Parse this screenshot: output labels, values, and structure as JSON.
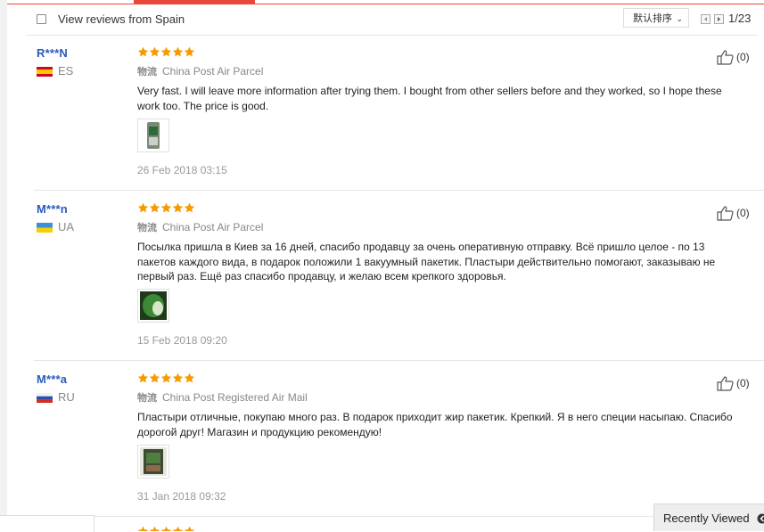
{
  "filter": {
    "label": "View reviews from Spain",
    "sort_label": "默认排序",
    "page_count": "1/23"
  },
  "reviews": [
    {
      "user": "R***N",
      "country": "ES",
      "stars": 5,
      "shipping_label": "物流",
      "shipping": "China Post Air Parcel",
      "text": "Very fast. I will leave more information after trying them. I bought from other sellers before and they worked, so I hope these work too. The price is good.",
      "date": "26 Feb 2018 03:15",
      "likes": "(0)"
    },
    {
      "user": "M***n",
      "country": "UA",
      "stars": 5,
      "shipping_label": "物流",
      "shipping": "China Post Air Parcel",
      "text": "Посылка пришла в Киев за 16 дней, спасибо продавцу за очень оперативную отправку. Всё пришло целое - по 13 пакетов каждого вида, в подарок положили 1 вакуумный пакетик. Пластыри действительно помогают, заказываю не первый раз. Ещё раз спасибо продавцу, и желаю всем крепкого здоровья.",
      "date": "15 Feb 2018 09:20",
      "likes": "(0)"
    },
    {
      "user": "M***a",
      "country": "RU",
      "stars": 5,
      "shipping_label": "物流",
      "shipping": "China Post Registered Air Mail",
      "text": "Пластыри отличные, покупаю много раз. В подарок приходит жир пакетик. Крепкий. Я в него специи насыпаю. Спасибо дорогой друг! Магазин и продукцию рекомендую!",
      "date": "31 Jan 2018 09:32",
      "likes": "(0)"
    }
  ],
  "recently_viewed": "Recently Viewed",
  "colors": {
    "accent": "#e8473a",
    "username": "#2a5bbc",
    "star": "#f59a00"
  }
}
